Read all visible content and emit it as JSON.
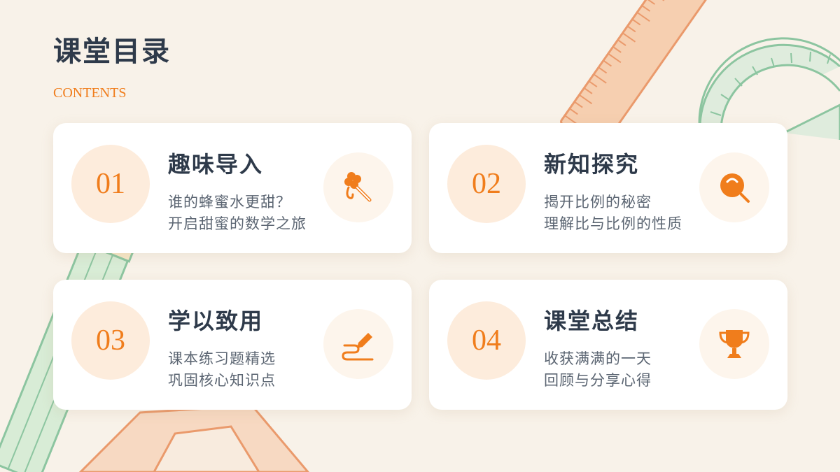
{
  "header": {
    "title": "课堂目录",
    "subtitle": "CONTENTS"
  },
  "accent_color": "#f07d1c",
  "cards": [
    {
      "number": "01",
      "title": "趣味导入",
      "lines": [
        "谁的蜂蜜水更甜？",
        "开启甜蜜的数学之旅"
      ],
      "icon": "honey-dipper-icon"
    },
    {
      "number": "02",
      "title": "新知探究",
      "lines": [
        "揭开比例的秘密",
        "理解比与比例的性质"
      ],
      "icon": "magnifier-icon"
    },
    {
      "number": "03",
      "title": "学以致用",
      "lines": [
        "课本练习题精选",
        "巩固核心知识点"
      ],
      "icon": "pencil-write-icon"
    },
    {
      "number": "04",
      "title": "课堂总结",
      "lines": [
        "收获满满的一天",
        "回顾与分享心得"
      ],
      "icon": "trophy-icon"
    }
  ]
}
